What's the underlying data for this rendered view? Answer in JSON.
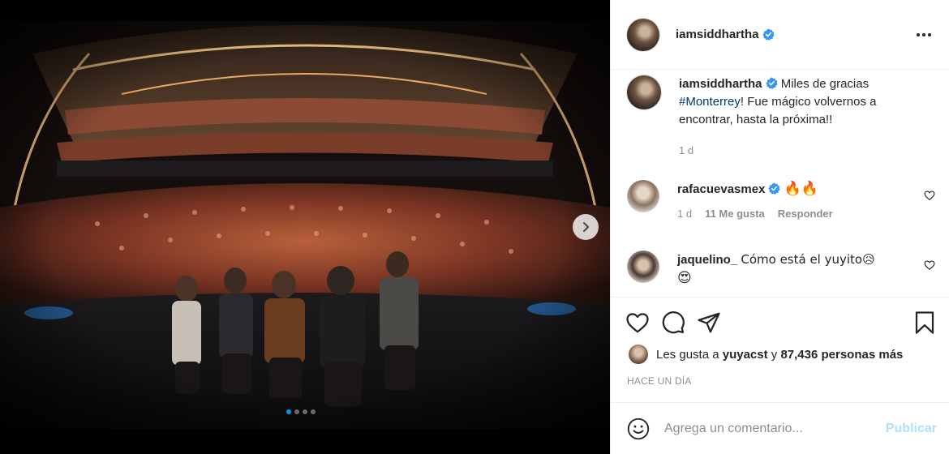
{
  "post": {
    "username": "iamsiddhartha",
    "verified": true,
    "more_icon": "more-options-icon"
  },
  "caption": {
    "username": "iamsiddhartha",
    "text_before": "Miles de gracias ",
    "hashtag": "#Monterrey",
    "text_after": "! Fue mágico volvernos a encontrar, hasta la próxima!!",
    "time": "1 d"
  },
  "comments": [
    {
      "username": "rafacuevasmex",
      "verified": true,
      "text": "🔥🔥",
      "time": "1 d",
      "likes": "11 Me gusta",
      "reply": "Responder"
    },
    {
      "username": "jaquelino_",
      "verified": false,
      "text": "Cómo está el yuyito😥",
      "text_line2": "😍"
    }
  ],
  "likes": {
    "prefix": "Les gusta a ",
    "user": "yuyacst",
    "middle": " y ",
    "count": "87,436 personas más"
  },
  "posted_ago": "HACE UN DÍA",
  "composer": {
    "placeholder": "Agrega un comentario...",
    "post_label": "Publicar"
  },
  "carousel": {
    "total": 4,
    "current": 1
  },
  "colors": {
    "accent": "#0095f6",
    "link": "#00376b",
    "muted": "#8e8e8e",
    "verified": "#3897f0"
  }
}
